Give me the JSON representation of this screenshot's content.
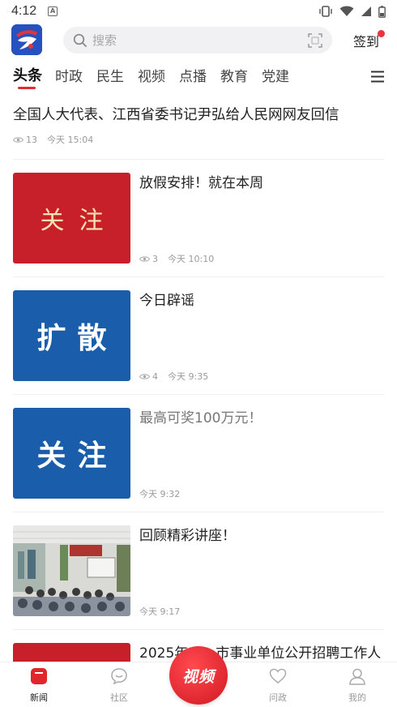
{
  "status": {
    "time": "4:12",
    "notif": "A"
  },
  "header": {
    "search_placeholder": "搜索",
    "sign_in": "签到"
  },
  "tabs": [
    {
      "label": "头条",
      "active": true
    },
    {
      "label": "时政"
    },
    {
      "label": "民生"
    },
    {
      "label": "视频"
    },
    {
      "label": "点播"
    },
    {
      "label": "教育"
    },
    {
      "label": "党建"
    }
  ],
  "top_article": {
    "title": "全国人大代表、江西省委书记尹弘给人民网网友回信",
    "views": "13",
    "time": "今天 15:04"
  },
  "items": [
    {
      "thumb_text": "关注",
      "thumb_color": "#c8202b",
      "title": "放假安排！就在本周",
      "views": "3",
      "time": "今天 10:10"
    },
    {
      "thumb_text": "扩散",
      "thumb_color": "#1a5eab",
      "title": "今日辟谣",
      "views": "4",
      "time": "今天 9:35"
    },
    {
      "thumb_text": "关注",
      "thumb_color": "#1a5eab",
      "title": "最高可奖100万元！",
      "time": "今天 9:32"
    },
    {
      "thumb_kind": "photo",
      "title": "回顾精彩讲座！",
      "time": "今天 9:17"
    },
    {
      "thumb_color": "#c8202b",
      "title": "2025年……市事业单位公开招聘工作人"
    }
  ],
  "bottom_nav": [
    {
      "label": "新闻",
      "icon": "news-icon",
      "active": true
    },
    {
      "label": "社区",
      "icon": "community-icon"
    },
    {
      "label": "视频",
      "icon": "video-icon"
    },
    {
      "label": "问政",
      "icon": "heart-icon"
    },
    {
      "label": "我的",
      "icon": "profile-icon"
    }
  ],
  "colors": {
    "accent": "#e02e2e",
    "brand_blue": "#1a5eab",
    "brand_red": "#c8202b"
  }
}
